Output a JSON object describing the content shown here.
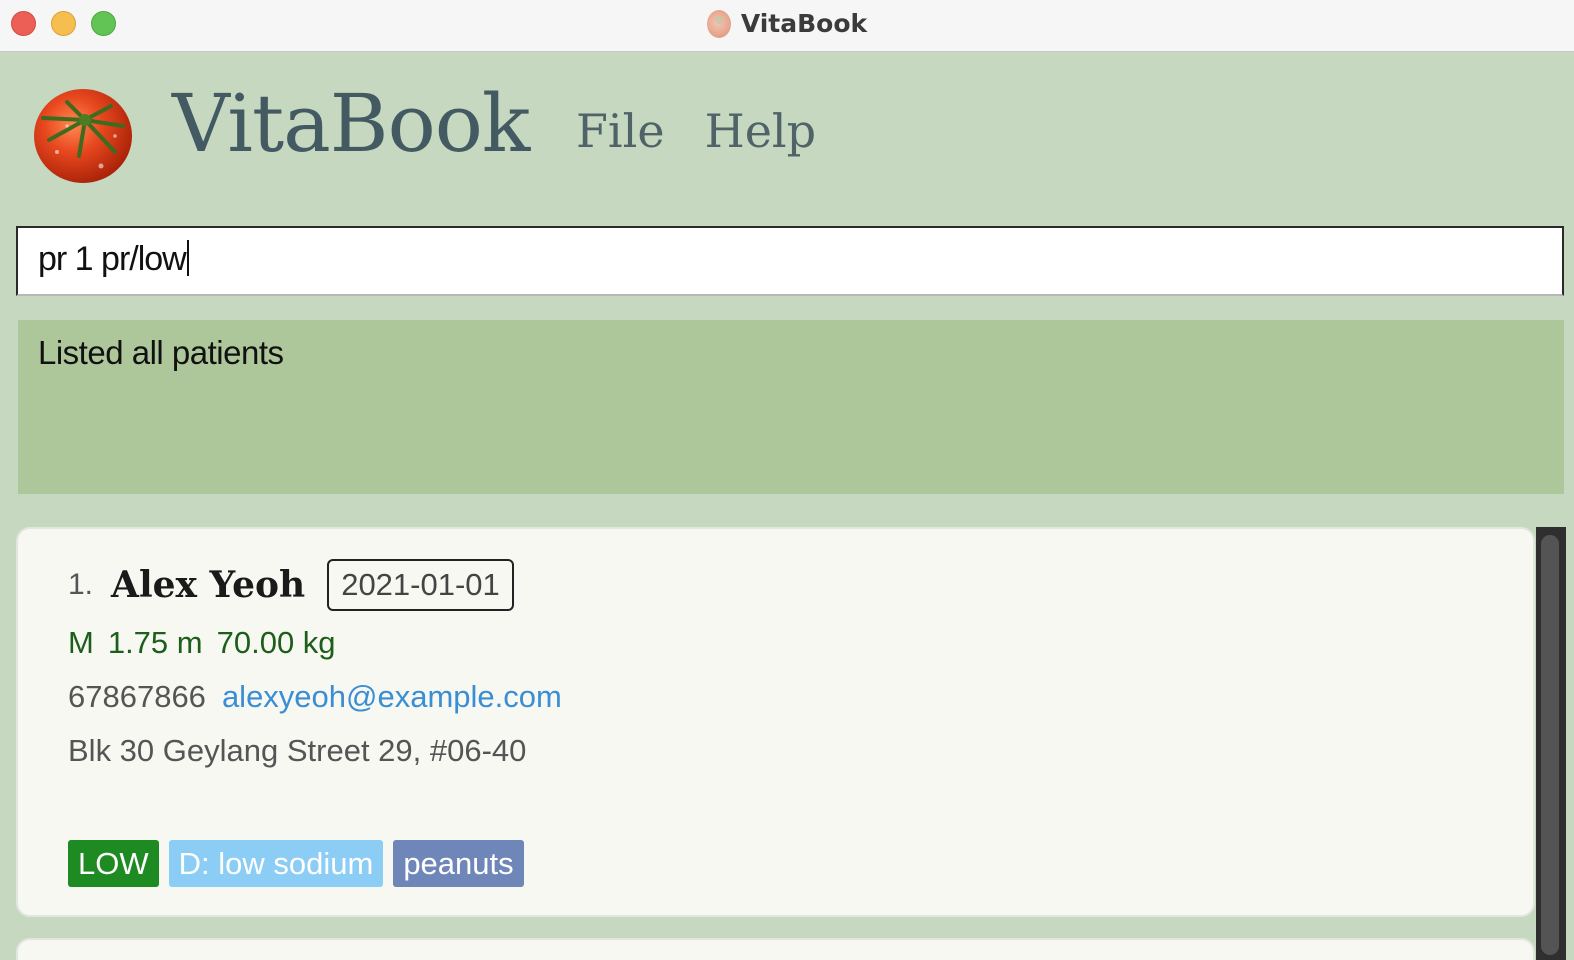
{
  "window": {
    "title": "VitaBook"
  },
  "header": {
    "brand": "VitaBook",
    "menu": [
      {
        "label": "File"
      },
      {
        "label": "Help"
      }
    ]
  },
  "command": {
    "value": "pr 1 pr/low"
  },
  "result": {
    "message": "Listed all patients"
  },
  "patients": [
    {
      "index": "1.",
      "name": "Alex Yeoh",
      "date": "2021-01-01",
      "sex": "M",
      "height": "1.75 m",
      "weight": "70.00 kg",
      "phone": "67867866",
      "email": "alexyeoh@example.com",
      "address": "Blk 30 Geylang Street 29, #06-40",
      "tags": [
        {
          "label": "LOW",
          "kind": "priority"
        },
        {
          "label": "D: low sodium",
          "kind": "diet"
        },
        {
          "label": "peanuts",
          "kind": "allergy"
        }
      ]
    }
  ],
  "colors": {
    "background": "#c6d8bf",
    "result_bg": "#adc69a",
    "brand_text": "#445a62",
    "priority_low": "#1d8a22",
    "diet_tag": "#8bcdf5",
    "allergy_tag": "#6f86b8",
    "email_link": "#3a8ed4",
    "vitals_text": "#1d5e1b"
  }
}
